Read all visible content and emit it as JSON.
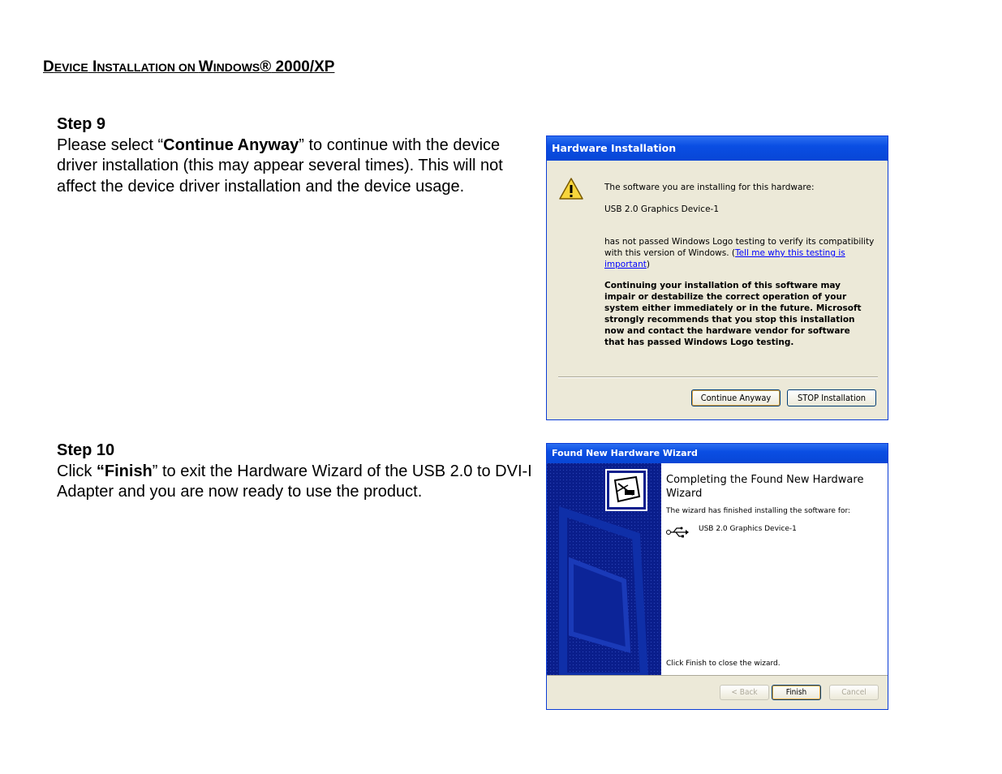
{
  "heading": {
    "d": "D",
    "evice": "EVICE",
    "space1": " ",
    "i": "I",
    "nstallation": "NSTALLATION",
    "on": " ON ",
    "w": "W",
    "indows": "INDOWS",
    "reg": "®",
    "rest": " 2000/XP"
  },
  "step9": {
    "title": "Step 9",
    "pre": "Please select “",
    "bold": "Continue Anyway",
    "post": "” to continue with the device driver installation (this may appear several times). This will not affect the device driver installation and the device usage."
  },
  "step10": {
    "title": "Step 10",
    "pre": "Click ",
    "bold": "“Finish",
    "post": "” to exit the Hardware Wizard of the USB 2.0 to DVI-I Adapter and you are now ready to use the product."
  },
  "dialog1": {
    "title": "Hardware Installation",
    "line1": "The software you are installing for this hardware:",
    "device": "USB 2.0 Graphics Device-1",
    "line3": "has not passed Windows Logo testing to verify its compatibility with this version of Windows. (",
    "link": "Tell me why this testing is important",
    "line3end": ")",
    "warning": "Continuing your installation of this software may impair or destabilize the correct operation of your system either immediately or in the future. Microsoft strongly recommends that you stop this installation now and contact the hardware vendor for software that has passed Windows Logo testing.",
    "btn_continue": "Continue Anyway",
    "btn_stop": "STOP Installation",
    "icon": "warning-icon"
  },
  "dialog2": {
    "title": "Found New Hardware Wizard",
    "heading": "Completing the Found New Hardware Wizard",
    "sub": "The wizard has finished installing the software for:",
    "device": "USB 2.0 Graphics Device-1",
    "close": "Click Finish to close the wizard.",
    "btn_back": "< Back",
    "btn_finish": "Finish",
    "btn_cancel": "Cancel"
  }
}
